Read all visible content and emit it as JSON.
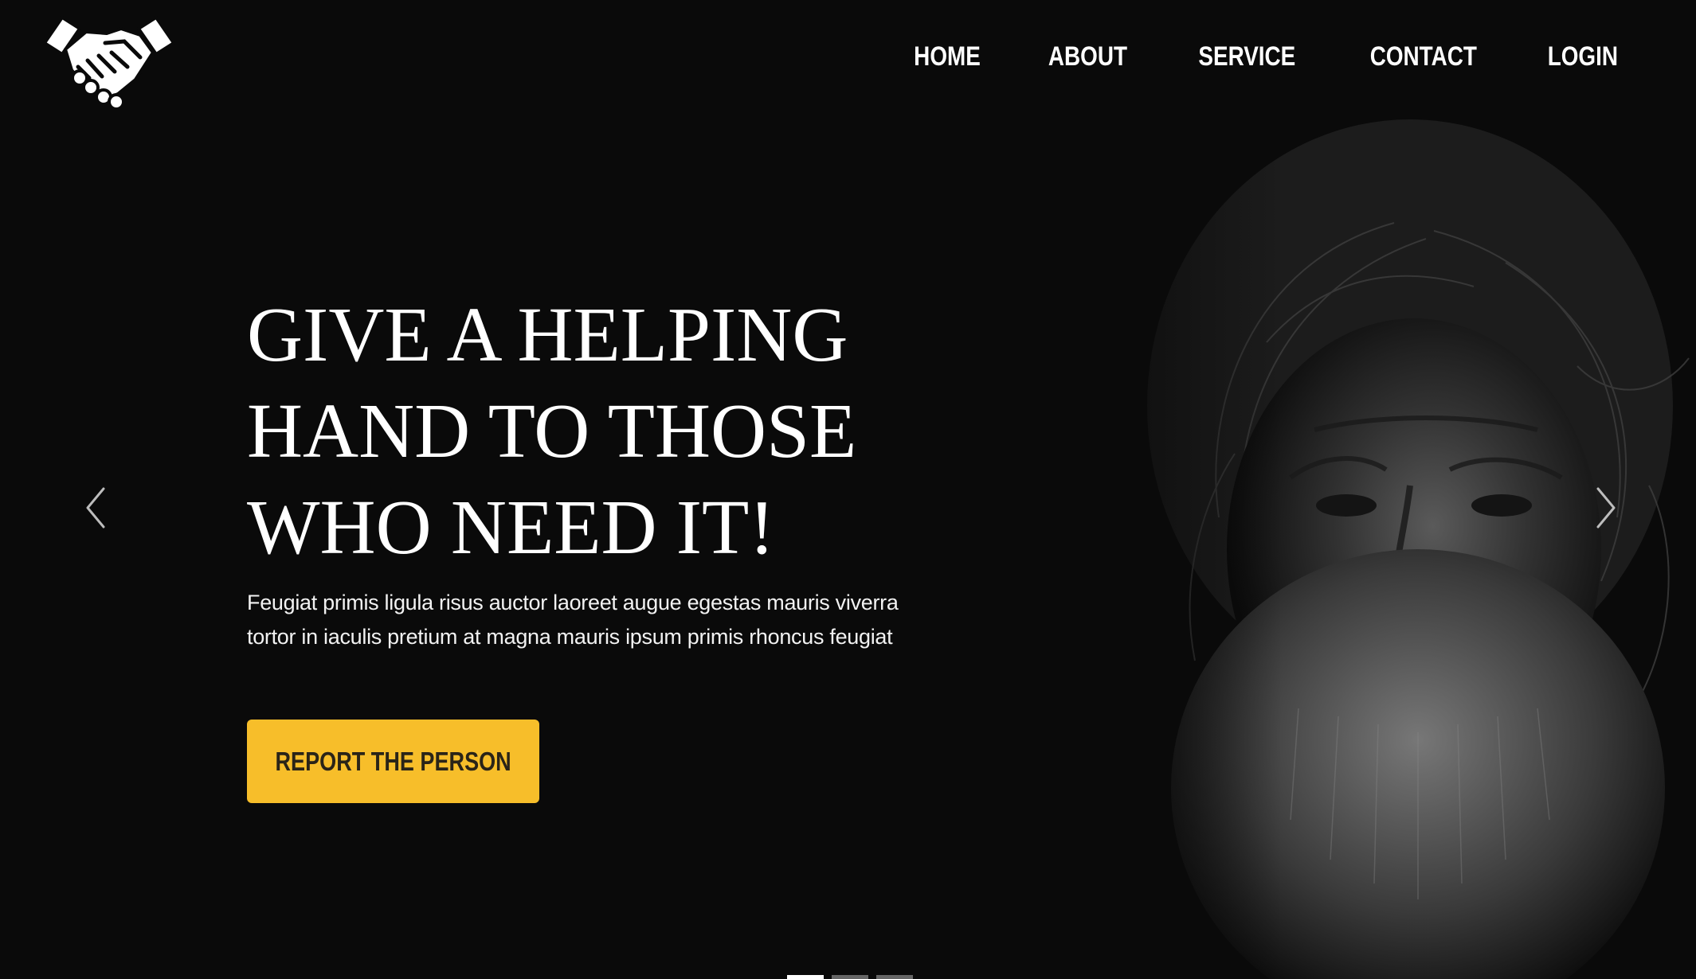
{
  "header": {
    "logo_icon": "handshake-icon",
    "nav": [
      {
        "label": "HOME"
      },
      {
        "label": "ABOUT"
      },
      {
        "label": "SERVICE"
      },
      {
        "label": "CONTACT"
      },
      {
        "label": "LOGIN"
      }
    ]
  },
  "hero": {
    "title_lines": [
      "GIVE A HELPING",
      "HAND TO THOSE",
      "WHO NEED IT!"
    ],
    "text": "Feugiat primis ligula risus auctor laoreet augue egestas mauris viverra tortor in iaculis pretium at magna mauris ipsum primis rhoncus feugiat",
    "cta_label": "REPORT THE PERSON"
  },
  "carousel": {
    "prev_icon": "chevron-left-icon",
    "next_icon": "chevron-right-icon",
    "slide_count": 3,
    "active_slide": 1
  },
  "colors": {
    "background": "#0a0a0a",
    "accent": "#f7be2a",
    "text": "#ffffff"
  }
}
